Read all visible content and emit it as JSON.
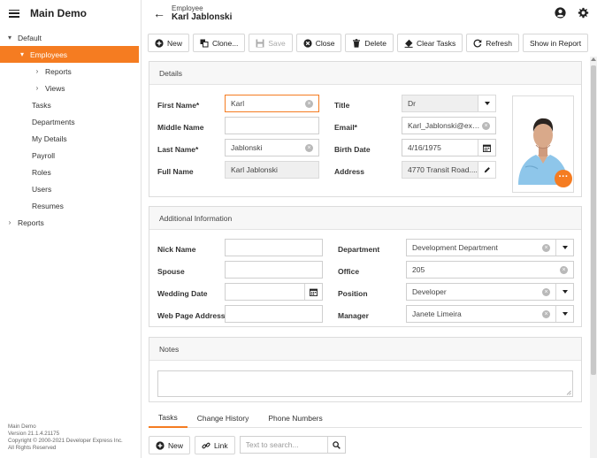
{
  "app": {
    "title": "Main Demo"
  },
  "sidebar": {
    "items": [
      {
        "label": "Default",
        "chevron": "▾"
      },
      {
        "label": "Employees",
        "chevron": "▾"
      },
      {
        "label": "Reports",
        "chevron": "›"
      },
      {
        "label": "Views",
        "chevron": "›"
      },
      {
        "label": "Tasks"
      },
      {
        "label": "Departments"
      },
      {
        "label": "My Details"
      },
      {
        "label": "Payroll"
      },
      {
        "label": "Roles"
      },
      {
        "label": "Users"
      },
      {
        "label": "Resumes"
      },
      {
        "label": "Reports",
        "chevron": "›"
      }
    ],
    "footer": {
      "line1": "Main Demo",
      "line2": "Version 21.1.4.21175",
      "line3": "Copyright © 2000-2021 Developer Express Inc.",
      "line4": "All Rights Reserved"
    }
  },
  "header": {
    "subtitle": "Employee",
    "title": "Karl Jablonski"
  },
  "toolbar": {
    "new": "New",
    "clone": "Clone...",
    "save": "Save",
    "close": "Close",
    "delete": "Delete",
    "clear_tasks": "Clear Tasks",
    "refresh": "Refresh",
    "show_in_report": "Show in Report"
  },
  "details": {
    "title": "Details",
    "first_name_label": "First Name*",
    "first_name": "Karl",
    "middle_name_label": "Middle Name",
    "middle_name": "",
    "last_name_label": "Last Name*",
    "last_name": "Jablonski",
    "full_name_label": "Full Name",
    "full_name": "Karl Jablonski",
    "title_label": "Title",
    "title_value": "Dr",
    "email_label": "Email*",
    "email": "Karl_Jablonski@exa...",
    "birth_label": "Birth Date",
    "birth": "4/16/1975",
    "address_label": "Address",
    "address": "4770 Transit Road...."
  },
  "additional": {
    "title": "Additional Information",
    "nick_label": "Nick Name",
    "spouse_label": "Spouse",
    "wedding_label": "Wedding Date",
    "web_label": "Web Page Address",
    "department_label": "Department",
    "department": "Development Department",
    "office_label": "Office",
    "office": "205",
    "position_label": "Position",
    "position": "Developer",
    "manager_label": "Manager",
    "manager": "Janete Limeira"
  },
  "notes": {
    "title": "Notes"
  },
  "tabs": [
    "Tasks",
    "Change History",
    "Phone Numbers"
  ],
  "bottom": {
    "new": "New",
    "link": "Link",
    "search_placeholder": "Text to search..."
  },
  "colors": {
    "accent": "#f57c21"
  }
}
